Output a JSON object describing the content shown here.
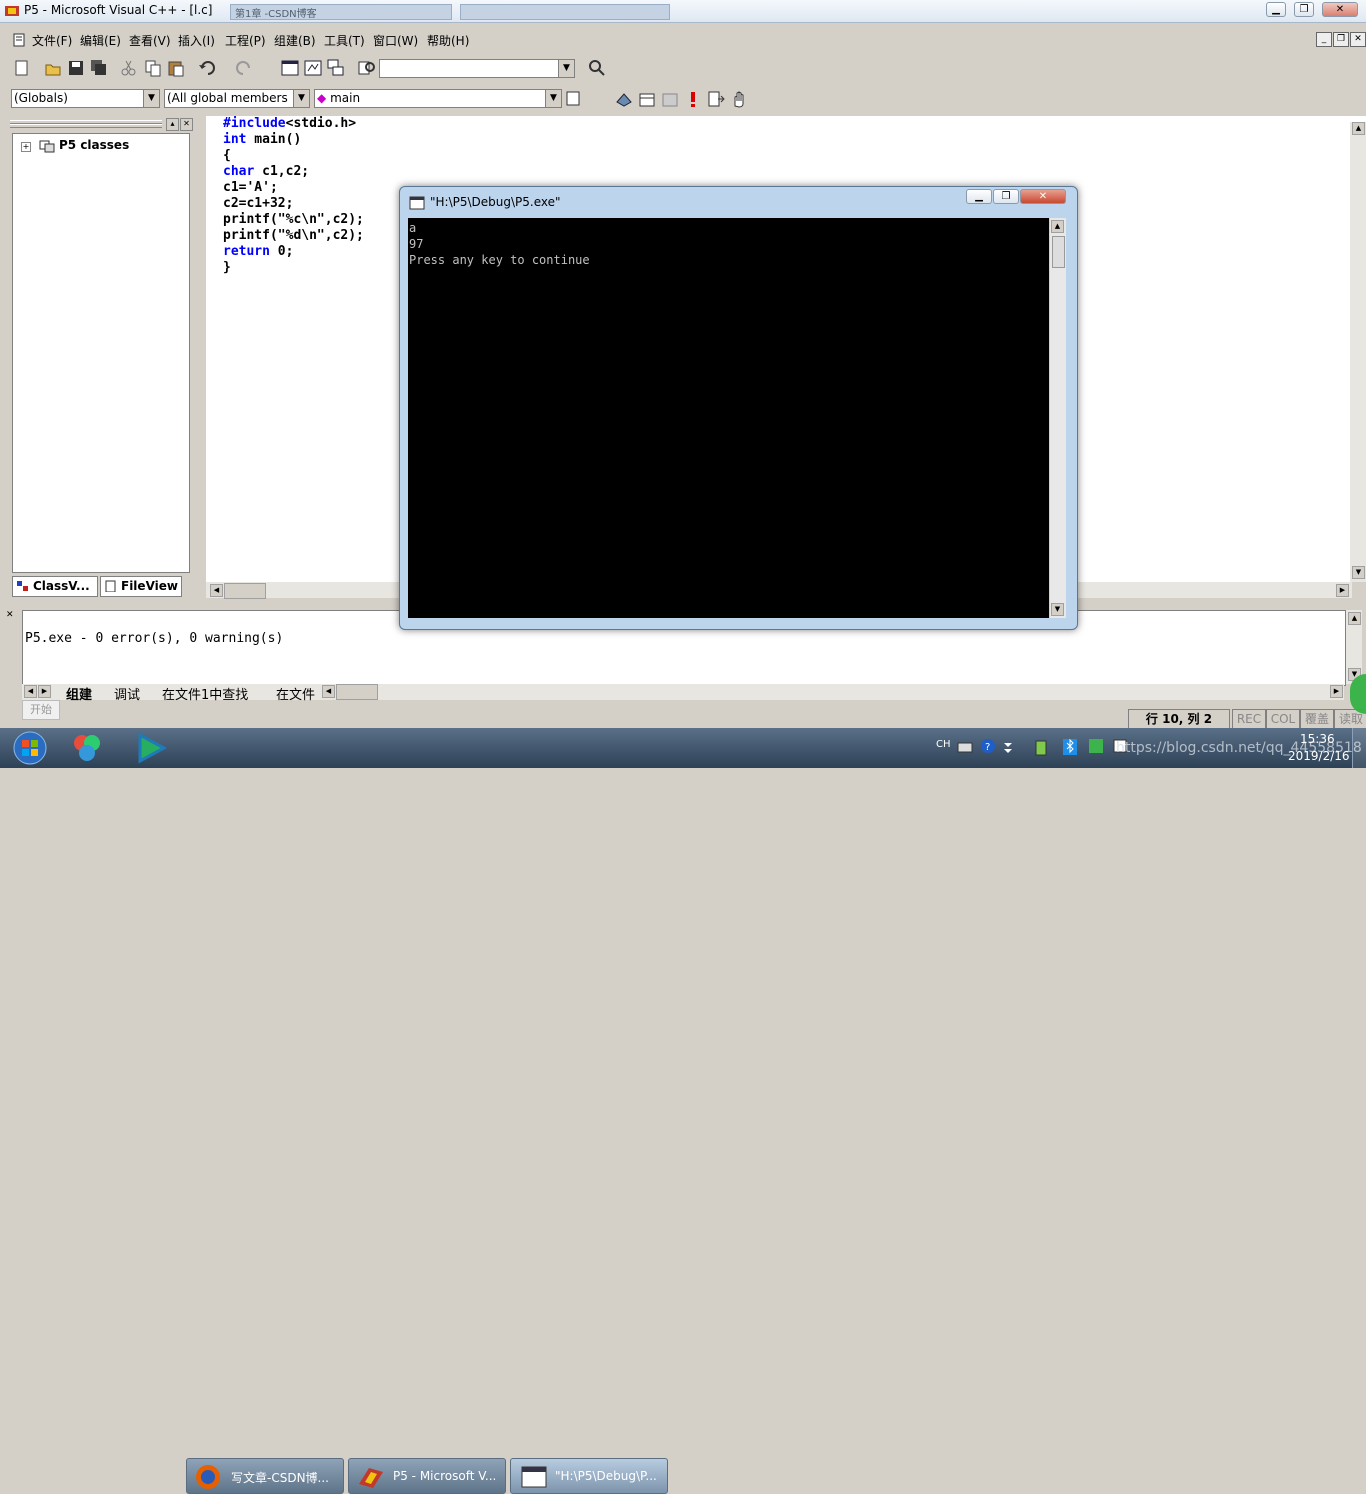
{
  "window": {
    "title": "P5 - Microsoft Visual C++ - [l.c]",
    "bg_tab_1": "第1章 -CSDN博客",
    "bg_tab_2": ""
  },
  "menu": [
    {
      "label": "文件(F)"
    },
    {
      "label": "编辑(E)"
    },
    {
      "label": "查看(V)"
    },
    {
      "label": "插入(I)"
    },
    {
      "label": "工程(P)"
    },
    {
      "label": "组建(B)"
    },
    {
      "label": "工具(T)"
    },
    {
      "label": "窗口(W)"
    },
    {
      "label": "帮助(H)"
    }
  ],
  "wizard": {
    "scope": "(Globals)",
    "members": "(All global members",
    "function": "main"
  },
  "tree": {
    "root": "P5 classes",
    "tab_class": "ClassV...",
    "tab_file": "FileView"
  },
  "editor": {
    "lines": [
      {
        "kw": "#include",
        "rest": "<stdio.h>"
      },
      {
        "kw": "int",
        "rest": " main()"
      },
      {
        "kw": "",
        "rest": "{"
      },
      {
        "kw": "char",
        "rest": " c1,c2;"
      },
      {
        "kw": "",
        "rest": "c1='A';"
      },
      {
        "kw": "",
        "rest": "c2=c1+32;"
      },
      {
        "kw": "",
        "rest": "printf(\"%c\\n\",c2);"
      },
      {
        "kw": "",
        "rest": "printf(\"%d\\n\",c2);"
      },
      {
        "kw": "return",
        "rest": " 0;"
      },
      {
        "kw": "",
        "rest": "}"
      }
    ]
  },
  "console": {
    "title": "\"H:\\P5\\Debug\\P5.exe\"",
    "lines": [
      "a",
      "97",
      "Press any key to continue"
    ]
  },
  "output": {
    "text": "P5.exe - 0 error(s), 0 warning(s)",
    "tabs": [
      "组建",
      "调试",
      "在文件1中查找",
      "在文件"
    ]
  },
  "status": {
    "start_hint": "开始",
    "position": "行 10, 列 2",
    "rec": "REC",
    "col": "COL",
    "ovr": "覆盖",
    "read": "读取"
  },
  "taskbar": {
    "items": [
      "写文章-CSDN博...",
      "P5 - Microsoft V...",
      "\"H:\\P5\\Debug\\P..."
    ],
    "tray_lang": "CH",
    "time": "15:36",
    "date": "2019/2/16",
    "watermark": "https://blog.csdn.net/qq_44558518"
  },
  "colors": {
    "keyword": "#0000ff",
    "console_bg": "#000000",
    "console_fg": "#c0c0c0"
  }
}
